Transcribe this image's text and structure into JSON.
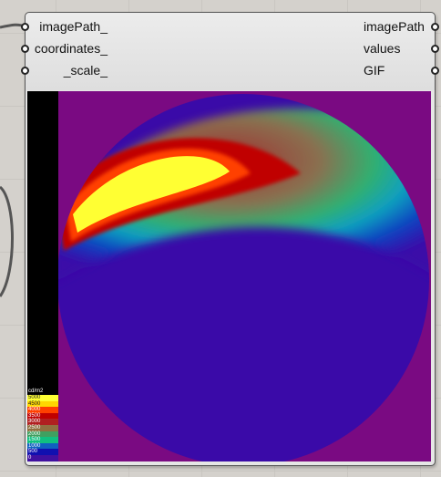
{
  "component": {
    "inputs": [
      "imagePath_",
      "coordinates_",
      "_scale_"
    ],
    "outputs": [
      "imagePath",
      "values",
      "GIF"
    ]
  },
  "viewer": {
    "legend": {
      "unit": "cd/m2",
      "labels": [
        "5000",
        "4500",
        "4000",
        "3500",
        "3000",
        "2500",
        "2000",
        "1500",
        "1000",
        "500",
        "0"
      ],
      "colors": [
        "#ffff33",
        "#ffd700",
        "#ff4000",
        "#c00000",
        "#b02020",
        "#907040",
        "#40a060",
        "#10c080",
        "#1060c0",
        "#1010b0",
        "#4010a0"
      ]
    },
    "colors": {
      "background": "#7a0a82",
      "disc_base": "#3a0aa8",
      "hotspot": "#ffff33"
    }
  }
}
